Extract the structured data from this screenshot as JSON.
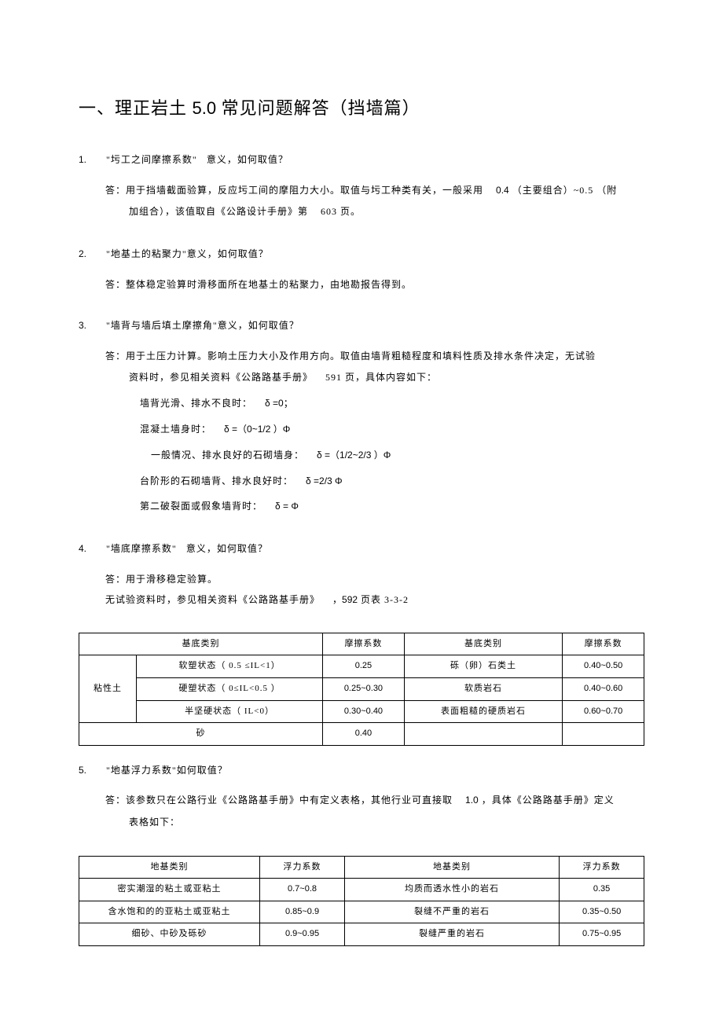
{
  "title_pre": "一、理正岩土",
  "title_num": "5.0",
  "title_post": "常见问题解答（挡墙篇）",
  "q1": {
    "num": "1.",
    "title": "\"圬工之间摩擦系数\"",
    "title_post": "意义，如何取值？",
    "a1_pre": "答：用于挡墙截面验算，反应圬工间的摩阻力大小。取值与圬工种类有关，一般采用",
    "a1_v1": "0.4",
    "a1_mid": "（主要组合）~0.5",
    "a1_post": "（附",
    "a2_pre": "加组合），该值取自《公路设计手册》第",
    "a2_v": "603",
    "a2_post": "页。"
  },
  "q2": {
    "num": "2.",
    "title": "\"地基土的粘聚力\"意义，如何取值？",
    "a1": "答：整体稳定验算时滑移面所在地基土的粘聚力，由地勘报告得到。"
  },
  "q3": {
    "num": "3.",
    "title": "\"墙背与墙后填土摩擦角\"意义，如何取值？",
    "a1": "答：用于土压力计算。影响土压力大小及作用方向。取值由墙背粗糙程度和填料性质及排水条件决定，无试验",
    "a2_pre": "资料时，参见相关资料《公路路基手册》",
    "a2_v": "591",
    "a2_post": "页，具体内容如下：",
    "l1_pre": "墙背光滑、排水不良时：",
    "l1_v": "δ =0；",
    "l2_pre": "混凝土墙身时：",
    "l2_v": "δ =（0~1/2 ）Φ",
    "l3_pre": "一般情况、排水良好的石砌墙身：",
    "l3_v": "δ =（1/2~2/3 ）Φ",
    "l4_pre": "台阶形的石砌墙背、排水良好时：",
    "l4_v": "δ =2/3 Φ",
    "l5_pre": "第二破裂面或假象墙背时：",
    "l5_v": "δ = Φ"
  },
  "q4": {
    "num": "4.",
    "title": "\"墙底摩擦系数\"",
    "title_post": "意义，如何取值？",
    "a1": "答：用于滑移稳定验算。",
    "a2_pre": "无试验资料时，参见相关资料《公路路基手册》",
    "a2_v": "，592",
    "a2_post": "页表 3-3-2"
  },
  "table1": {
    "h1": "基底类别",
    "h2": "摩擦系数",
    "h3": "基底类别",
    "h4": "摩擦系数",
    "rowhead": "粘性土",
    "r1c1": "软塑状态（ 0.5 ≤IL<1）",
    "r1c2": "0.25",
    "r1c3": "砾（卵）石类土",
    "r1c4": "0.40~0.50",
    "r2c1": "硬塑状态（ 0≤IL<0.5 ）",
    "r2c2": "0.25~0.30",
    "r2c3": "软质岩石",
    "r2c4": "0.40~0.60",
    "r3c1": "半坚硬状态（ IL<0）",
    "r3c2": "0.30~0.40",
    "r3c3": "表面粗糙的硬质岩石",
    "r3c4": "0.60~0.70",
    "r4c1": "砂",
    "r4c2": "0.40",
    "r4c3": "",
    "r4c4": ""
  },
  "q5": {
    "num": "5.",
    "title": "\"地基浮力系数\"如何取值？",
    "a1_pre": "答：该参数只在公路行业《公路路基手册》中有定义表格，其他行业可直接取",
    "a1_v": "1.0",
    "a1_post": "，具体《公路路基手册》定义",
    "a2": "表格如下："
  },
  "table2": {
    "h1": "地基类别",
    "h2": "浮力系数",
    "h3": "地基类别",
    "h4": "浮力系数",
    "r1c1": "密实潮湿的粘土或亚粘土",
    "r1c2": "0.7~0.8",
    "r1c3": "均质而透水性小的岩石",
    "r1c4": "0.35",
    "r2c1": "含水饱和的的亚粘土或亚粘土",
    "r2c2": "0.85~0.9",
    "r2c3": "裂缝不严重的岩石",
    "r2c4": "0.35~0.50",
    "r3c1": "细砂、中砂及砾砂",
    "r3c2": "0.9~0.95",
    "r3c3": "裂缝严重的岩石",
    "r3c4": "0.75~0.95"
  }
}
